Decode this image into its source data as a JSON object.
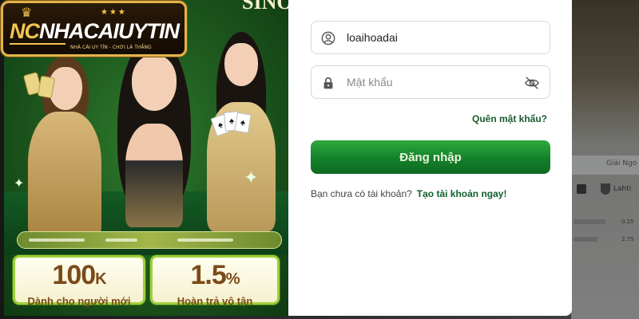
{
  "logo": {
    "brand_prefix": "NC",
    "brand_main": "NHACAIUYTIN",
    "tagline": "NHÀ CÁI UY TÍN - CHƠI LÀ THẮNG"
  },
  "promo": {
    "header_text": "SINO",
    "bonus_left": {
      "value": "100",
      "unit": "K",
      "label": "Dành cho người mới"
    },
    "bonus_right": {
      "value": "1.5",
      "unit": "%",
      "label": "Hoàn trả vô tận"
    }
  },
  "login": {
    "username_value": "loaihoadai",
    "password_placeholder": "Mật khẩu",
    "forgot_label": "Quên mật khẩu?",
    "submit_label": "Đăng nhập",
    "register_prompt": "Bạn chưa có tài khoản?",
    "register_link": "Tạo tài khoản ngay!"
  },
  "background": {
    "tab_label": "Giải Ngo",
    "team_label": "Lahti",
    "odds": [
      "0.25",
      "2.75"
    ]
  },
  "icons": {
    "user": "user-icon",
    "lock": "lock-icon",
    "eye_off": "eye-off-icon",
    "crown": "crown-icon"
  },
  "colors": {
    "brand_green": "#14802a",
    "link_green": "#1a5b2e",
    "gold": "#e3b34a",
    "bonus_text": "#7b4a1a"
  }
}
